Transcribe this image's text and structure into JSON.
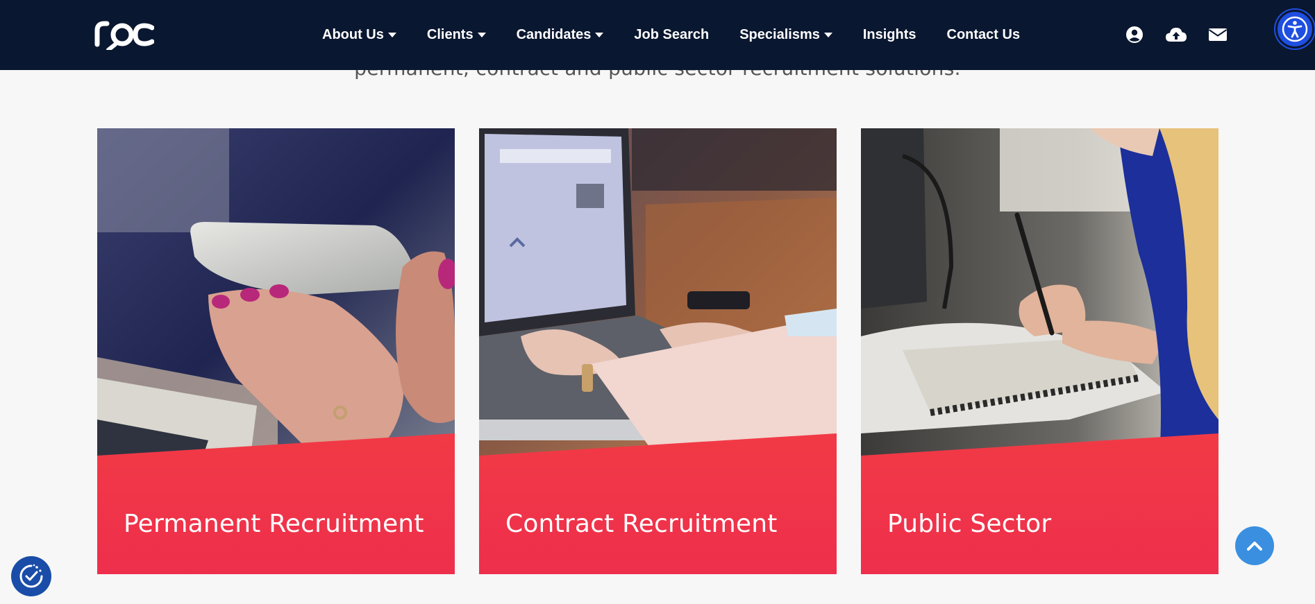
{
  "intro": {
    "text": "permanent, contract and public sector recruitment solutions."
  },
  "header": {
    "logo_text": "roc",
    "nav": [
      {
        "label": "About Us",
        "dropdown": true
      },
      {
        "label": "Clients",
        "dropdown": true
      },
      {
        "label": "Candidates",
        "dropdown": true
      },
      {
        "label": "Job Search",
        "dropdown": false
      },
      {
        "label": "Specialisms",
        "dropdown": true
      },
      {
        "label": "Insights",
        "dropdown": false
      },
      {
        "label": "Contact Us",
        "dropdown": false
      }
    ],
    "icons": [
      "user-icon",
      "cloud-upload-icon",
      "envelope-icon"
    ]
  },
  "cards": [
    {
      "label": "Permanent Recruitment",
      "image": "hand-holding-phone-photo"
    },
    {
      "label": "Contract Recruitment",
      "image": "typing-on-laptop-photo"
    },
    {
      "label": "Public Sector",
      "image": "writing-in-notebook-photo"
    }
  ],
  "colors": {
    "header_bg": "#0a1730",
    "card_gradient_top": "#f8522f",
    "card_gradient_bottom": "#ee2f4c",
    "accessibility_blue": "#1f4fe0",
    "scroll_top_blue": "#3a8fe0"
  }
}
